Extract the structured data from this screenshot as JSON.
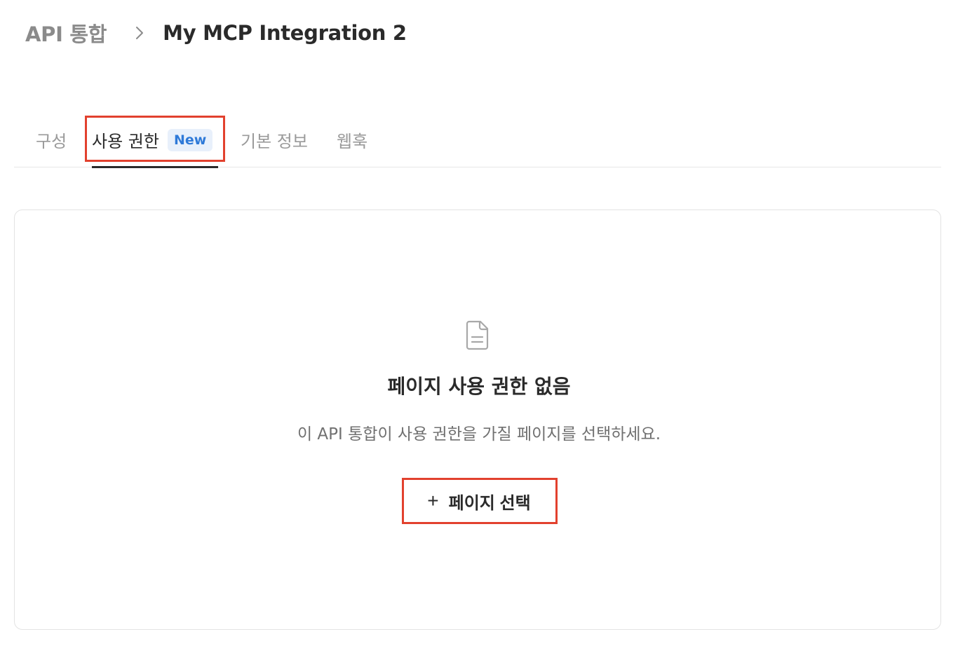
{
  "breadcrumb": {
    "parent": "API 통합",
    "current": "My MCP Integration 2",
    "separator_icon": "chevron-right-icon"
  },
  "tabs": [
    {
      "label": "구성",
      "active": false
    },
    {
      "label": "사용 권한",
      "active": true,
      "badge": "New"
    },
    {
      "label": "기본 정보",
      "active": false
    },
    {
      "label": "웹훅",
      "active": false
    }
  ],
  "empty_state": {
    "icon": "document-icon",
    "title": "페이지 사용 권한 없음",
    "description": "이 API 통합이 사용 권한을 가질 페이지를 선택하세요.",
    "button_icon": "plus-icon",
    "button_label": "페이지 선택"
  },
  "colors": {
    "highlight": "#e2412e",
    "badge_text": "#2f7ad8",
    "badge_bg": "#e8f0fb"
  }
}
